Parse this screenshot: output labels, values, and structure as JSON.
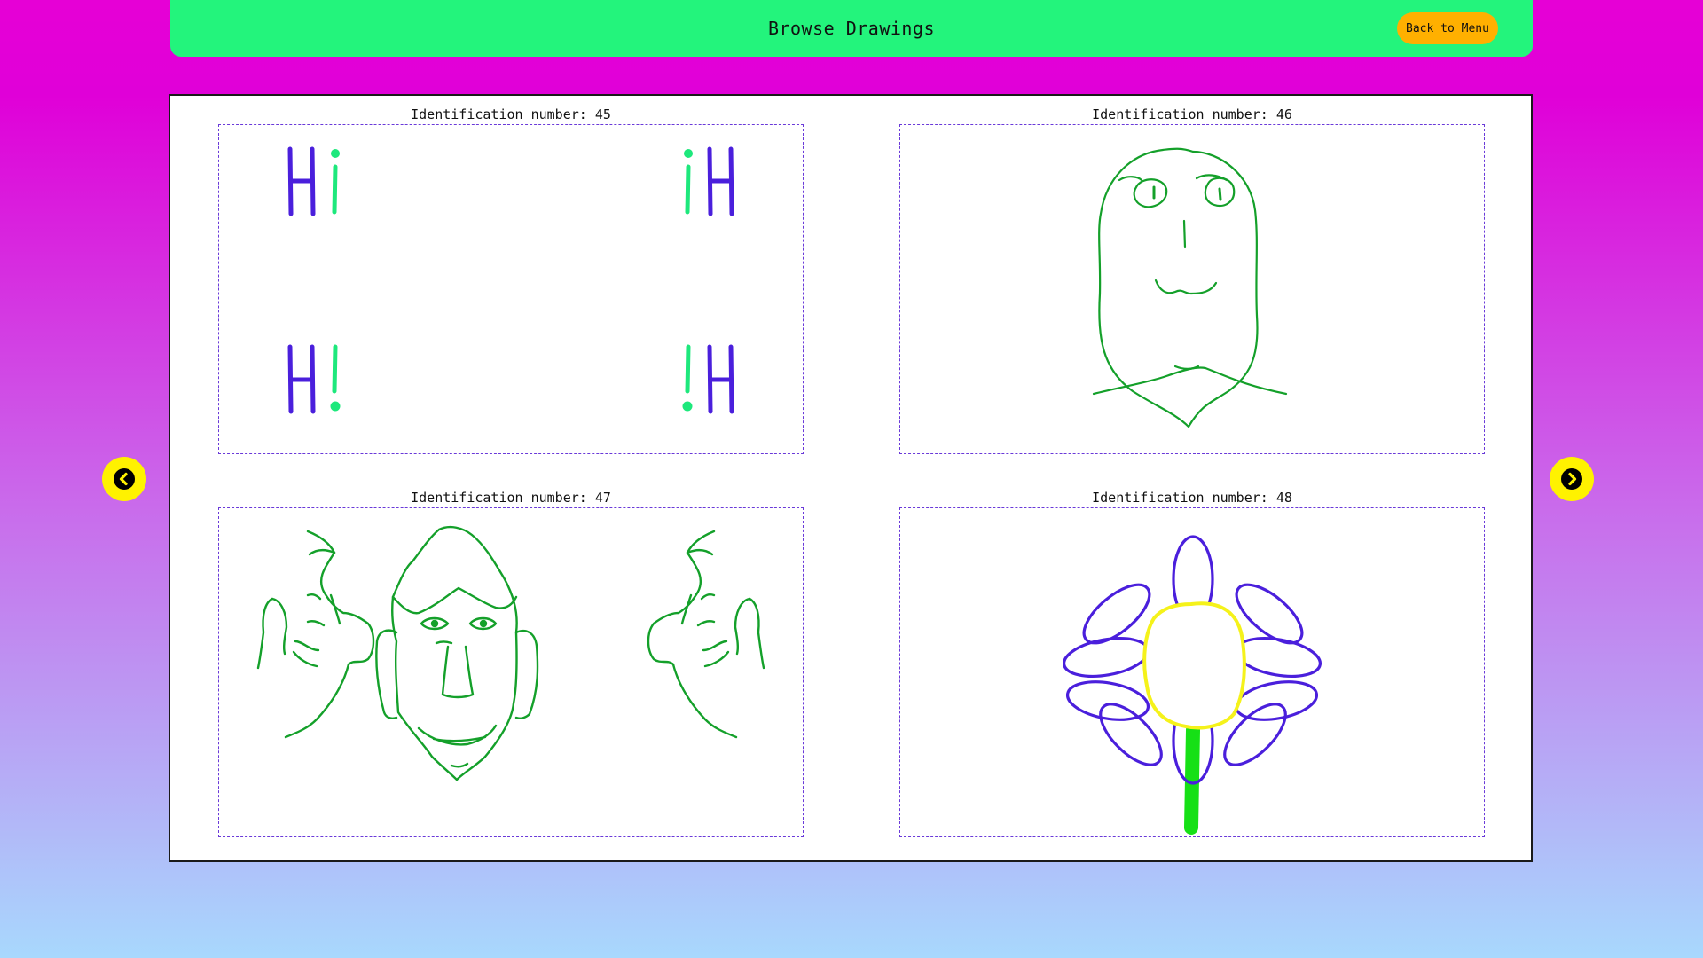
{
  "header": {
    "title": "Browse Drawings",
    "menu_button": "Back to Menu"
  },
  "colors": {
    "header_bg": "#23f47c",
    "menu_button_bg": "#ffb000",
    "nav_button_bg": "#fff200",
    "frame_border": "#6a3ad9",
    "ink_green": "#14a02a",
    "ink_purple": "#4a1fdc",
    "ink_mint": "#1de87c",
    "ink_yellow": "#f5f21a",
    "ink_bright_green": "#16e016"
  },
  "drawings": [
    {
      "label": "Identification number: 45"
    },
    {
      "label": "Identification number: 46"
    },
    {
      "label": "Identification number: 47"
    },
    {
      "label": "Identification number: 48"
    }
  ],
  "nav": {
    "prev_icon": "chevron-left-icon",
    "next_icon": "chevron-right-icon"
  }
}
